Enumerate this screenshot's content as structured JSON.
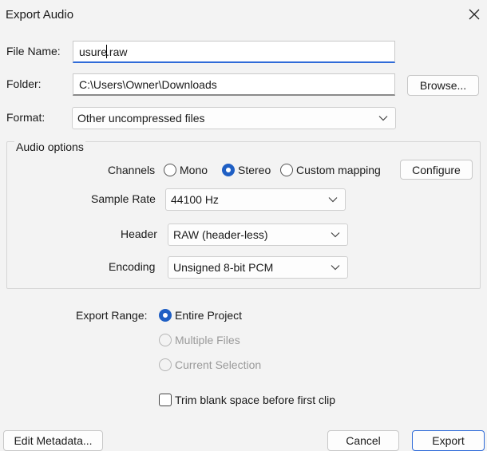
{
  "window": {
    "title": "Export Audio"
  },
  "file_name": {
    "label": "File Name:",
    "value_before_cursor": "usure",
    "value_after_cursor": ".raw"
  },
  "folder": {
    "label": "Folder:",
    "value": "C:\\Users\\Owner\\Downloads",
    "browse_label": "Browse..."
  },
  "format": {
    "label": "Format:",
    "value": "Other uncompressed files"
  },
  "audio_options": {
    "title": "Audio options",
    "channels": {
      "label": "Channels",
      "options": [
        "Mono",
        "Stereo",
        "Custom mapping"
      ],
      "selected": "Stereo",
      "configure_label": "Configure"
    },
    "sample_rate": {
      "label": "Sample Rate",
      "value": "44100 Hz"
    },
    "header": {
      "label": "Header",
      "value": "RAW (header-less)"
    },
    "encoding": {
      "label": "Encoding",
      "value": "Unsigned 8-bit PCM"
    }
  },
  "export_range": {
    "label": "Export Range:",
    "options": [
      "Entire Project",
      "Multiple Files",
      "Current Selection"
    ],
    "selected": "Entire Project"
  },
  "trim": {
    "label": "Trim blank space before first clip",
    "checked": false
  },
  "buttons": {
    "edit_metadata": "Edit Metadata...",
    "cancel": "Cancel",
    "export": "Export"
  },
  "colors": {
    "accent": "#1f5fc4",
    "background": "#f3f3f3"
  }
}
